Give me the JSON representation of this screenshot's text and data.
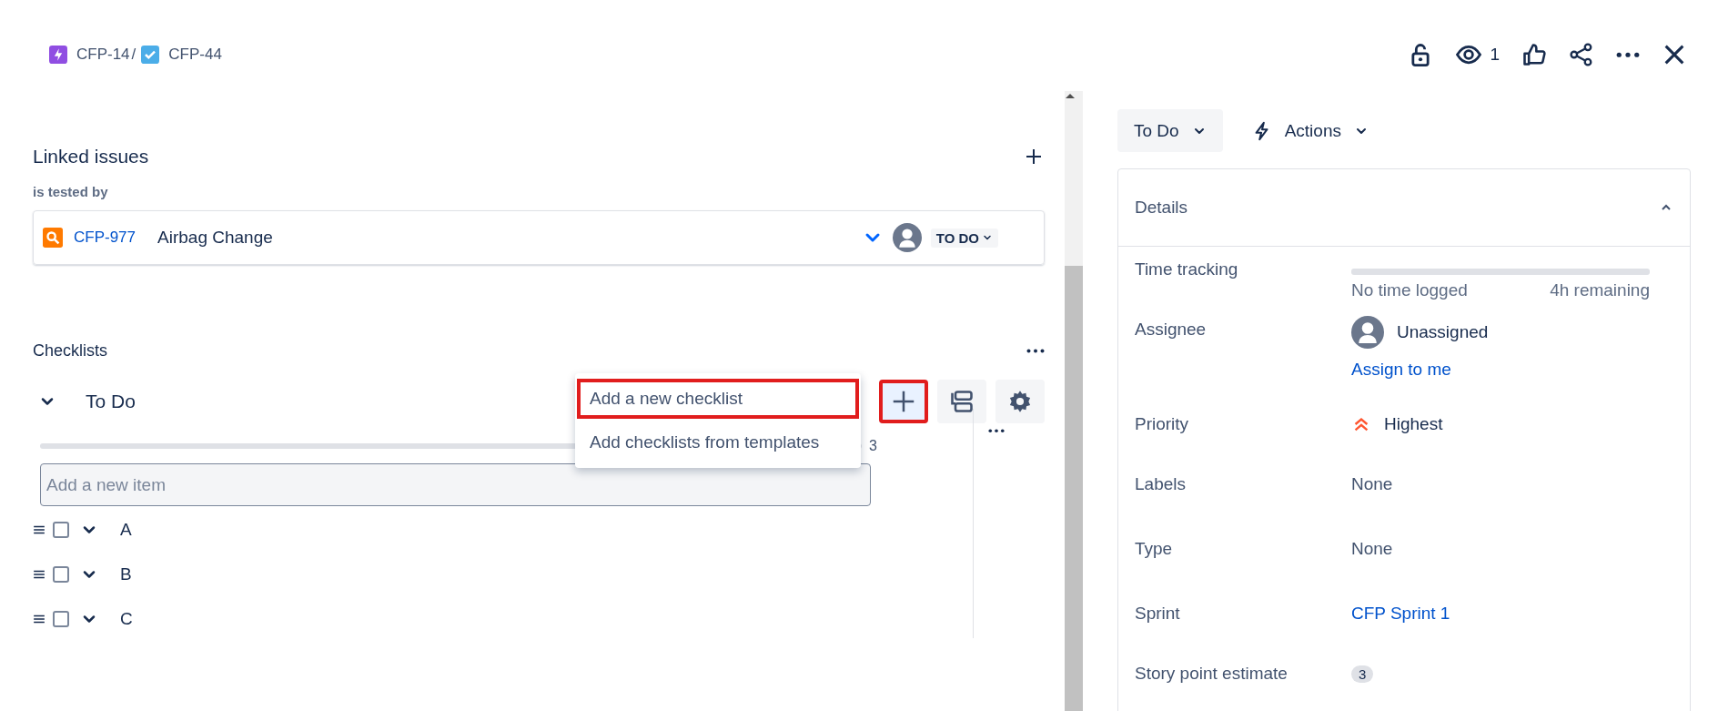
{
  "breadcrumb": [
    {
      "key": "CFP-14",
      "kind": "epic"
    },
    {
      "key": "CFP-44",
      "kind": "task"
    }
  ],
  "breadcrumb_separator": "/",
  "header": {
    "watch_count": "1"
  },
  "linked_issues": {
    "title": "Linked issues",
    "relation": "is tested by",
    "items": [
      {
        "key": "CFP-977",
        "summary": "Airbag Change",
        "status": "TO DO"
      }
    ]
  },
  "checklists": {
    "title": "Checklists",
    "add_highlighted": true,
    "menu": [
      {
        "label": "Add a new checklist",
        "highlighted": true
      },
      {
        "label": "Add checklists from templates",
        "highlighted": false
      }
    ],
    "lists": [
      {
        "name": "To Do",
        "expanded": true,
        "level": 0,
        "progress_text": "3",
        "placeholder": "Add a new item",
        "items": [
          {
            "text": "A",
            "checked": false
          },
          {
            "text": "B",
            "checked": false
          },
          {
            "text": "C",
            "checked": false
          }
        ]
      }
    ]
  },
  "status_button": "To Do",
  "actions_button": "Actions",
  "details": {
    "title": "Details",
    "expanded": true,
    "fields": [
      {
        "label": "Time tracking",
        "kind": "time",
        "logged": "No time logged",
        "remaining": "4h remaining",
        "level": 0
      },
      {
        "label": "Assignee",
        "kind": "user",
        "value": "Unassigned",
        "link": "Assign to me"
      },
      {
        "label": "Priority",
        "kind": "priority",
        "value": "Highest"
      },
      {
        "label": "Labels",
        "kind": "plain",
        "value": "None"
      },
      {
        "label": "Type",
        "kind": "plain",
        "value": "None"
      },
      {
        "label": "Sprint",
        "kind": "link",
        "value": "CFP Sprint 1"
      },
      {
        "label": "Story point estimate",
        "kind": "badge",
        "value": "3"
      }
    ]
  }
}
